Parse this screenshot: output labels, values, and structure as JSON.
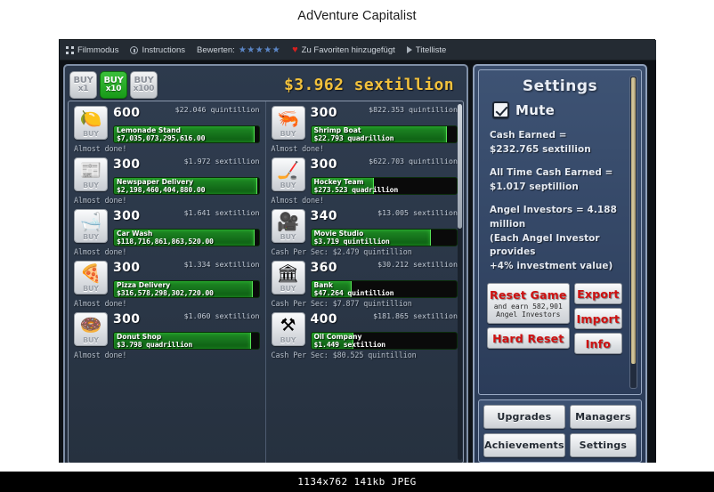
{
  "site": {
    "title": "AdVenture Capitalist"
  },
  "toolbar": {
    "film_mode": "Filmmodus",
    "instructions": "Instructions",
    "rate_label": "Bewerten:",
    "stars": "★★★★★",
    "favorite": "Zu Favoriten hinzugefügt",
    "title_list": "Titelliste"
  },
  "game": {
    "cash_total": "$3.962 sextillion",
    "buy_multipliers": [
      {
        "top": "BUY",
        "bottom": "x1",
        "active": false
      },
      {
        "top": "BUY",
        "bottom": "x10",
        "active": true
      },
      {
        "top": "BUY",
        "bottom": "x100",
        "active": false
      }
    ],
    "buy_label": "BUY",
    "businesses_left": [
      {
        "name": "Lemonade Stand",
        "icon": "lemon-icon",
        "glyph": "🍋",
        "count": "600",
        "cost": "$22.046 quintillion",
        "revenue": "$7,035,073,295,616.00",
        "progress": 97,
        "status": "Almost done!"
      },
      {
        "name": "Newspaper Delivery",
        "icon": "newspaper-icon",
        "glyph": "📰",
        "count": "300",
        "cost": "$1.972 sextillion",
        "revenue": "$2,198,460,404,880.00",
        "progress": 99,
        "status": "Almost done!"
      },
      {
        "name": "Car Wash",
        "icon": "carwash-icon",
        "glyph": "🛁",
        "count": "300",
        "cost": "$1.641 sextillion",
        "revenue": "$118,716,861,863,520.00",
        "progress": 97,
        "status": "Almost done!"
      },
      {
        "name": "Pizza Delivery",
        "icon": "pizza-icon",
        "glyph": "🍕",
        "count": "300",
        "cost": "$1.334 sextillion",
        "revenue": "$316,578,298,302,720.00",
        "progress": 96,
        "status": "Almost done!"
      },
      {
        "name": "Donut Shop",
        "icon": "donut-icon",
        "glyph": "🍩",
        "count": "300",
        "cost": "$1.060 sextillion",
        "revenue": "$3.798 quadrillion",
        "progress": 95,
        "status": "Almost done!"
      }
    ],
    "businesses_right": [
      {
        "name": "Shrimp Boat",
        "icon": "shrimp-icon",
        "glyph": "🦐",
        "count": "300",
        "cost": "$822.353 quintillion",
        "revenue": "$22.793 quadrillion",
        "progress": 93,
        "status": "Almost done!"
      },
      {
        "name": "Hockey Team",
        "icon": "hockey-icon",
        "glyph": "🏒",
        "count": "300",
        "cost": "$622.703 quintillion",
        "revenue": "$273.523 quadrillion",
        "progress": 43,
        "status": "Almost done!"
      },
      {
        "name": "Movie Studio",
        "icon": "movie-camera-icon",
        "glyph": "🎥",
        "count": "340",
        "cost": "$13.005 sextillion",
        "revenue": "$3.719 quintillion",
        "progress": 82,
        "status": "Cash Per Sec: $2.479 quintillion"
      },
      {
        "name": "Bank",
        "icon": "bank-icon",
        "glyph": "🏛",
        "count": "360",
        "cost": "$30.212 sextillion",
        "revenue": "$47.264 quintillion",
        "progress": 28,
        "status": "Cash Per Sec: $7.877 quintillion"
      },
      {
        "name": "Oil Company",
        "icon": "oil-rig-icon",
        "glyph": "⚒",
        "count": "400",
        "cost": "$181.865 sextillion",
        "revenue": "$1.449 sextillion",
        "progress": 29,
        "status": "Cash Per Sec: $80.525 quintillion"
      }
    ]
  },
  "settings": {
    "title": "Settings",
    "mute_label": "Mute",
    "mute_checked": true,
    "stats": [
      "Cash Earned =",
      "$232.765 sextillion",
      "All Time Cash Earned =",
      "$1.017 septillion",
      "Angel Investors = 4.188 million",
      "(Each Angel Investor provides",
      "+4% investment value)"
    ],
    "stat_groups": [
      {
        "lines": [
          "Cash Earned =",
          "$232.765 sextillion"
        ]
      },
      {
        "lines": [
          "All Time Cash Earned =",
          "$1.017 septillion"
        ]
      },
      {
        "lines": [
          "Angel Investors = 4.188 million",
          "(Each Angel Investor provides",
          "+4% investment value)"
        ]
      }
    ],
    "reset_game": "Reset Game",
    "reset_game_sub": "and earn 582,901\nAngel Investors",
    "hard_reset": "Hard Reset",
    "export": "Export",
    "import": "Import",
    "info": "Info"
  },
  "nav": {
    "upgrades": "Upgrades",
    "managers": "Managers",
    "achievements": "Achievements",
    "settings": "Settings"
  },
  "footer": {
    "caption": "1134x762 141kb JPEG"
  }
}
